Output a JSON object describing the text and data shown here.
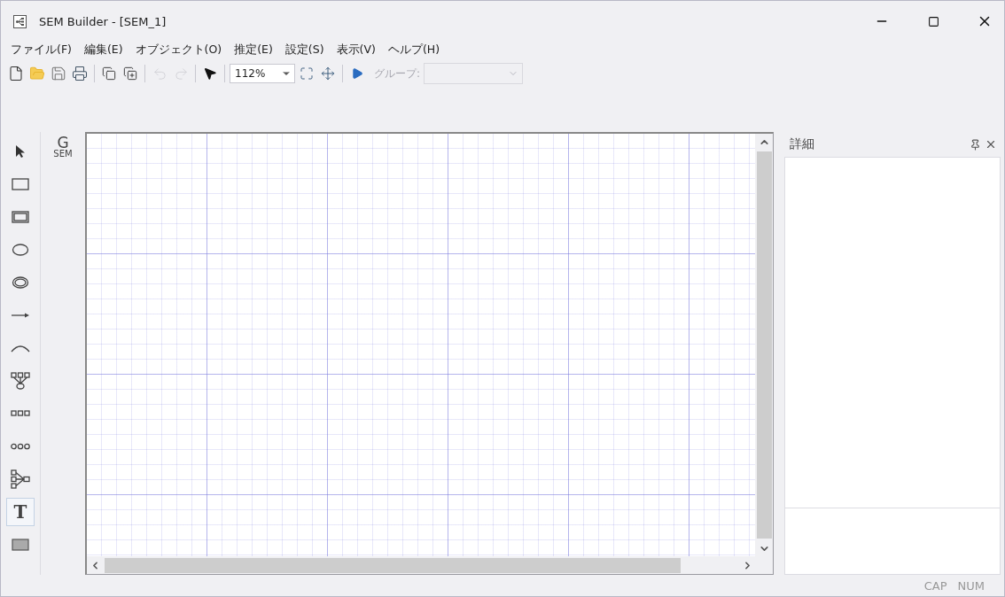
{
  "window": {
    "title": "SEM Builder - [SEM_1]"
  },
  "menu": [
    {
      "label": "ファイル(F)"
    },
    {
      "label": "編集(E)"
    },
    {
      "label": "オブジェクト(O)"
    },
    {
      "label": "推定(E)"
    },
    {
      "label": "設定(S)"
    },
    {
      "label": "表示(V)"
    },
    {
      "label": "ヘルプ(H)"
    }
  ],
  "toolbar": {
    "buttons": [
      {
        "kind": "new",
        "disabled": false
      },
      {
        "kind": "open",
        "disabled": false
      },
      {
        "kind": "save",
        "disabled": false
      },
      {
        "kind": "print",
        "disabled": false
      },
      {
        "kind": "sep"
      },
      {
        "kind": "copy",
        "disabled": false
      },
      {
        "kind": "add",
        "disabled": false
      },
      {
        "kind": "sep"
      },
      {
        "kind": "undo",
        "disabled": true
      },
      {
        "kind": "redo",
        "disabled": true
      },
      {
        "kind": "sep"
      },
      {
        "kind": "pointer",
        "disabled": false
      },
      {
        "kind": "sep"
      }
    ],
    "zoom": "112%",
    "after": [
      {
        "kind": "fit",
        "disabled": false
      },
      {
        "kind": "center",
        "disabled": false
      },
      {
        "kind": "sep"
      },
      {
        "kind": "run",
        "disabled": false
      }
    ],
    "group_label": "グループ:",
    "group_disabled": true
  },
  "tools": [
    {
      "kind": "pointer",
      "selected": false
    },
    {
      "kind": "rect",
      "selected": false
    },
    {
      "kind": "double-rect",
      "selected": false
    },
    {
      "kind": "ellipse",
      "selected": false
    },
    {
      "kind": "double-ellipse",
      "selected": false
    },
    {
      "kind": "arrow",
      "selected": false
    },
    {
      "kind": "curve",
      "selected": false
    },
    {
      "kind": "factor",
      "selected": false
    },
    {
      "kind": "boxes",
      "selected": false
    },
    {
      "kind": "circles",
      "selected": false
    },
    {
      "kind": "paths",
      "selected": false
    },
    {
      "kind": "text",
      "label": "T",
      "selected": true
    },
    {
      "kind": "filled-rect",
      "selected": false
    }
  ],
  "sem_button": {
    "letter": "G",
    "caption": "SEM"
  },
  "details": {
    "title": "詳細"
  },
  "status_bar": [
    "CAP",
    "NUM"
  ]
}
